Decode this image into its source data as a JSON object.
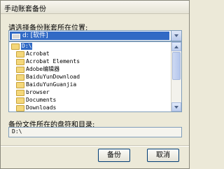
{
  "window": {
    "title": "手动账套备份"
  },
  "selection": {
    "prompt": "请选择备份账套所在位置:",
    "drive_combo": {
      "value": "d: [软件]",
      "icon": "drive-icon"
    },
    "folder_list": {
      "items": [
        {
          "label": "D:\\",
          "selected": true,
          "icon": "open-folder-icon"
        },
        {
          "label": "Acrobat",
          "selected": false,
          "icon": "folder-icon"
        },
        {
          "label": "Acrobat Elements",
          "selected": false,
          "icon": "folder-icon"
        },
        {
          "label": "Adobe编辑器",
          "selected": false,
          "icon": "folder-icon"
        },
        {
          "label": "BaiduYunDownload",
          "selected": false,
          "icon": "folder-icon"
        },
        {
          "label": "BaiduYunGuanjia",
          "selected": false,
          "icon": "folder-icon"
        },
        {
          "label": "browser",
          "selected": false,
          "icon": "folder-icon"
        },
        {
          "label": "Documents",
          "selected": false,
          "icon": "folder-icon"
        },
        {
          "label": "Downloads",
          "selected": false,
          "icon": "folder-icon"
        }
      ]
    }
  },
  "destination": {
    "label": "备份文件所在的盘符和目录:",
    "path": "D:\\"
  },
  "buttons": {
    "ok_label": "备份",
    "cancel_label": "取消"
  }
}
